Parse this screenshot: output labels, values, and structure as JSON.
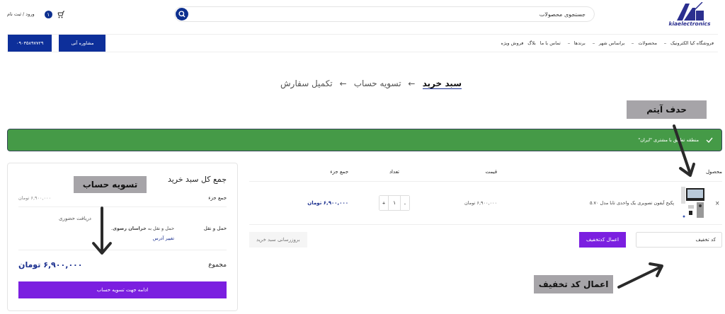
{
  "header": {
    "logo_text": "kiaelectronics",
    "search": {
      "placeholder": "جستجوی محصولات"
    },
    "cart_count": "۱",
    "login": "ورود / ثبت نام"
  },
  "nav": {
    "items": [
      {
        "label": "فروشگاه کیا الکترونیک",
        "has_dropdown": true
      },
      {
        "label": "محصولات",
        "has_dropdown": true
      },
      {
        "label": "براساس شهر",
        "has_dropdown": true
      },
      {
        "label": "برندها",
        "has_dropdown": true
      },
      {
        "label": "تماس با ما",
        "has_dropdown": false
      },
      {
        "label": "بلاگ",
        "has_dropdown": false
      },
      {
        "label": "فروش ویژه",
        "has_dropdown": false
      }
    ],
    "buttons": [
      "مشاوره آنی",
      "۰۹۰۳۵۸۹۷۷۲۹"
    ]
  },
  "steps": [
    {
      "label": "سبد خرید",
      "selected": true,
      "arrow": "←"
    },
    {
      "label": "تسویه حساب",
      "selected": false,
      "arrow": "←"
    },
    {
      "label": "تکمیل سفارش",
      "selected": false
    }
  ],
  "notice": {
    "text": "منطقه تطبیق با مشتری \"ایران\""
  },
  "cart": {
    "columns": [
      "محصول",
      "قیمت",
      "تعداد",
      "جمع جزء"
    ],
    "rows": [
      {
        "remove": "×",
        "name": "پکیج آیفون تصویری یک واحدی تابا مدل ۵.۷۰",
        "price": "۶,۹۰۰,۰۰۰ تومان",
        "quantity": "۱",
        "minus": "-",
        "plus": "+",
        "subtotal": "۶,۹۰۰,۰۰۰ تومان"
      }
    ],
    "coupon": {
      "placeholder": "کد تخفیف",
      "button": "اعمال کدتخفیف"
    },
    "update_button": {
      "label": "بروزرسانی سبد خرید",
      "disabled": true
    }
  },
  "totals": {
    "title": "جمع کل سبد خرید",
    "subtotal_label": "جمع جزء",
    "subtotal_value": "۶,۹۰۰,۰۰۰ تومان",
    "shipping_label": "حمل و نقل",
    "shipping_method": "دریافت حضوری",
    "shipping_destination": "حمل و نقل به **خراسان رضوی**.",
    "change_address": "تغییر آدرس",
    "total_label": "مجموع",
    "total_value": "۶,۹۰۰,۰۰۰ تومان",
    "checkout_button": "ادامه جهت تسویه حساب"
  },
  "annotations": [
    {
      "text": "حدف آیتم"
    },
    {
      "text": "تسویه حساب"
    },
    {
      "text": "اعمال کد تخفیف"
    }
  ]
}
